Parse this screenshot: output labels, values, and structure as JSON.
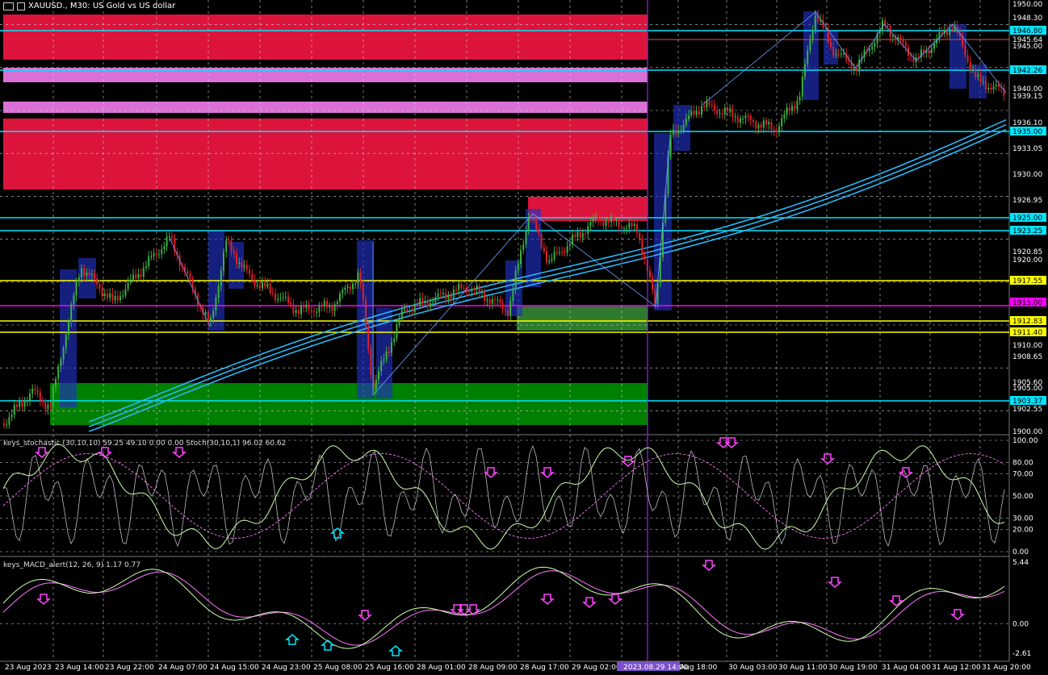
{
  "window": {
    "symbol_title": "XAUUSD., M30:  US Gold vs US dollar"
  },
  "main_chart": {
    "price_axis_labels": [
      "1950.00",
      "1948.30",
      "1946.80",
      "1945.64",
      "1945.00",
      "1942.26",
      "1940.00",
      "1939.15",
      "1936.10",
      "1935.00",
      "1933.05",
      "1930.00",
      "1926.95",
      "1925.00",
      "1923.25",
      "1920.85",
      "1920.00",
      "1917.55",
      "1915.00",
      "1912.83",
      "1911.40",
      "1910.00",
      "1908.65",
      "1905.60",
      "1905.00",
      "1903.37",
      "1902.55",
      "1900.00"
    ],
    "highlighted_levels": [
      {
        "label": "1946.80",
        "color": "#00e5ff"
      },
      {
        "label": "1942.26",
        "color": "#00e5ff"
      },
      {
        "label": "1935.00",
        "color": "#00e5ff"
      },
      {
        "label": "1925.00",
        "color": "#00e5ff"
      },
      {
        "label": "1923.25",
        "color": "#00e5ff"
      },
      {
        "label": "1917.55",
        "color": "#ffff00"
      },
      {
        "label": "1915.00",
        "color": "#ff00ff"
      },
      {
        "label": "1912.83",
        "color": "#ffff00"
      },
      {
        "label": "1911.40",
        "color": "#ffff00"
      },
      {
        "label": "1903.37",
        "color": "#00e5ff"
      }
    ]
  },
  "stochastic": {
    "title": "keys_stochastic (30,10,10) 59.25 49.10 0.00 0.00 Stoch(30,10,1) 96.02 60.62",
    "axis_labels": [
      "100.00",
      "80.00",
      "70.00",
      "50.00",
      "30.00",
      "20.00",
      "0.00"
    ]
  },
  "macd": {
    "title": "keys_MACD_alert(12, 26, 9) 1.17 0.77",
    "axis_labels": [
      "5.44",
      "0.00",
      "-2.61"
    ]
  },
  "time_axis": {
    "labels": [
      "23 Aug 2023",
      "23 Aug 14:00",
      "23 Aug 22:00",
      "24 Aug 07:00",
      "24 Aug 15:00",
      "24 Aug 23:00",
      "25 Aug 08:00",
      "25 Aug 16:00",
      "28 Aug 01:00",
      "28 Aug 09:00",
      "28 Aug 17:00",
      "29 Aug 02:00",
      "2023.08.29 14:00",
      "Aug 18:00",
      "30 Aug 03:00",
      "30 Aug 11:00",
      "30 Aug 19:00",
      "31 Aug 04:00",
      "31 Aug 12:00",
      "31 Aug 20:00"
    ]
  },
  "colors": {
    "background": "#000000",
    "bull_candle": "#3cb043",
    "bear_candle": "#e0202a",
    "supply_zone": "#dc143c",
    "demand_zone": "#008000",
    "pink_zone": "#da70d6",
    "ma_lines": "#29b6f6",
    "cursor_line": "#8a2be2",
    "grid": "#cfcfcf"
  }
}
